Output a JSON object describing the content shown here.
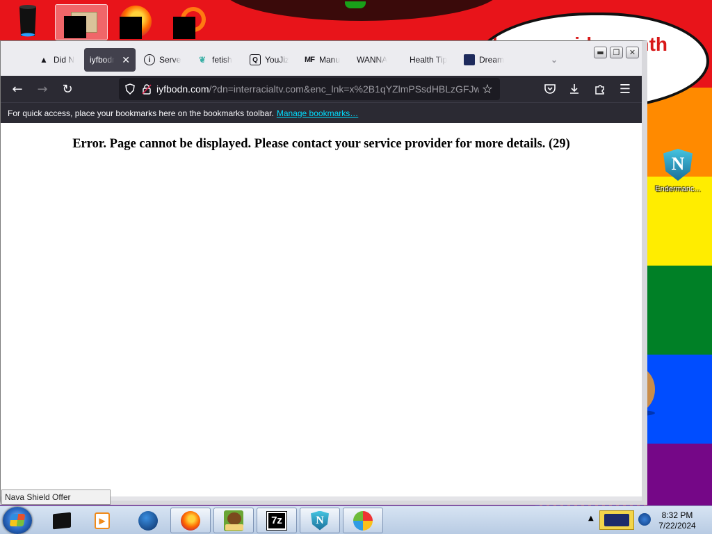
{
  "desktop": {
    "bubble_text": "happy pride month",
    "icons": [
      {
        "label": "Endermanc..."
      }
    ]
  },
  "browser": {
    "tabs": [
      {
        "label": "Did N",
        "icon": "warning-icon"
      },
      {
        "label": "iyfbodn",
        "icon": "none",
        "active": true
      },
      {
        "label": "Server",
        "icon": "info-icon"
      },
      {
        "label": "fetish",
        "icon": "leaf-icon"
      },
      {
        "label": "YouJiz",
        "icon": "q-icon"
      },
      {
        "label": "Manu",
        "icon": "mf-icon"
      },
      {
        "label": "WANNA",
        "icon": "none"
      },
      {
        "label": "Health Tip",
        "icon": "none"
      },
      {
        "label": "Dream",
        "icon": "dream-icon"
      }
    ],
    "url": {
      "host": "iyfbodn.com",
      "rest": "/?dn=interracialtv.com&enc_lnk=x%2B1qYZlmPSsdHBLzGFJw"
    },
    "bookmarks_bar": {
      "text": "For quick access, place your bookmarks here on the bookmarks toolbar.",
      "link": "Manage bookmarks…"
    },
    "page": {
      "error": "Error. Page cannot be displayed. Please contact your service provider for more details. (29)"
    },
    "status_tooltip": "Nava Shield Offer"
  },
  "taskbar": {
    "time": "8:32 PM",
    "date": "7/22/2024"
  },
  "colors": {
    "firefox_dark": "#2b2a33",
    "url_bg": "#1c1b22",
    "link": "#00ddff"
  }
}
